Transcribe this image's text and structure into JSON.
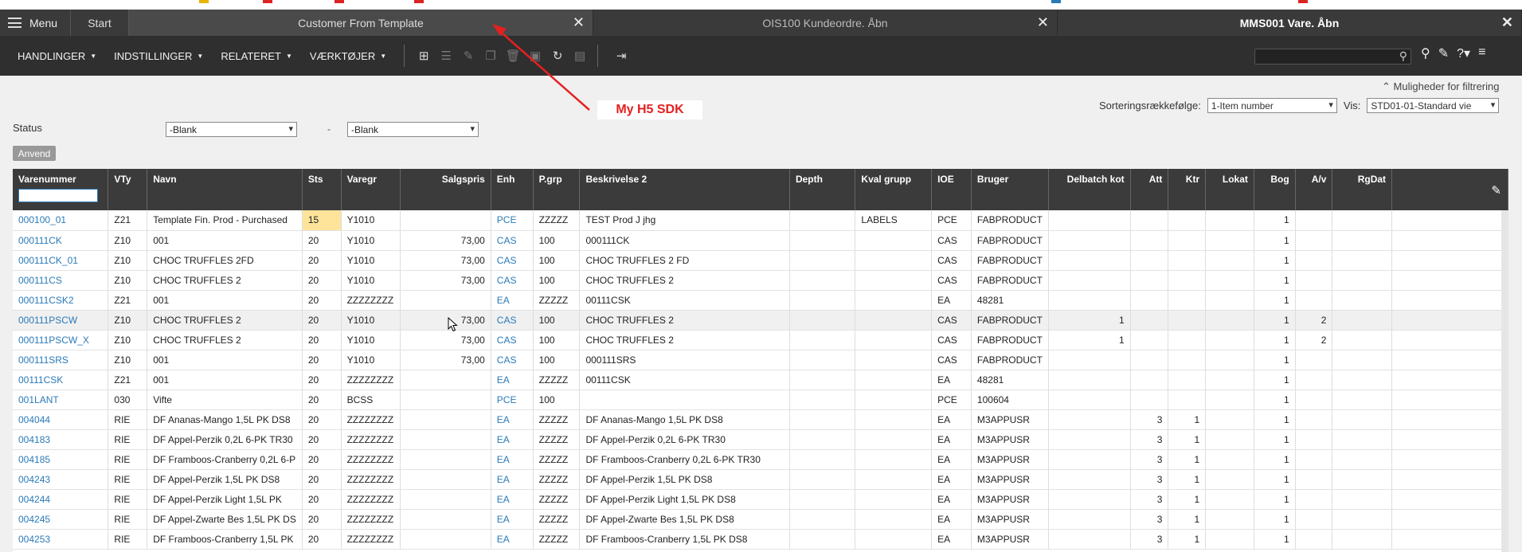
{
  "tabs": {
    "menu_label": "Menu",
    "start_label": "Start",
    "items": [
      {
        "title": "Customer From Template",
        "close": "✕"
      },
      {
        "title": "OIS100 Kundeordre. Åbn",
        "close": "✕"
      },
      {
        "title": "MMS001 Vare. Åbn",
        "close": "✕"
      }
    ]
  },
  "toolbar": {
    "menus": [
      "HANDLINGER",
      "INDSTILLINGER",
      "RELATERET",
      "VÆRKTØJER"
    ]
  },
  "filter": {
    "show_options": "Muligheder for filtrering",
    "sort_label": "Sorteringsrækkefølge:",
    "sort_value": "1-Item number",
    "view_label": "Vis:",
    "view_value": "STD01-01-Standard vie",
    "status_label": "Status",
    "status_from": "-Blank",
    "dash": "-",
    "status_to": "-Blank",
    "apply_label": "Anvend"
  },
  "annotation": "My H5 SDK",
  "grid": {
    "columns": [
      "Varenummer",
      "VTy",
      "Navn",
      "Sts",
      "Varegr",
      "Salgspris",
      "Enh",
      "P.grp",
      "Beskrivelse 2",
      "Depth",
      "Kval grupp",
      "IOE",
      "Bruger",
      "Delbatch kot",
      "Att",
      "Ktr",
      "Lokat",
      "Bog",
      "A/v",
      "RgDat"
    ],
    "rows": [
      [
        "000100_01",
        "Z21",
        "Template Fin. Prod - Purchased",
        "15",
        "Y1010",
        "",
        "PCE",
        "ZZZZZ",
        "TEST Prod J jhg",
        "",
        "LABELS",
        "PCE",
        "FABPRODUCT",
        "",
        "",
        "",
        "",
        "1",
        "",
        ""
      ],
      [
        "000111CK",
        "Z10",
        "001",
        "20",
        "Y1010",
        "73,00",
        "CAS",
        "100",
        "000111CK",
        "",
        "",
        "CAS",
        "FABPRODUCT",
        "",
        "",
        "",
        "",
        "1",
        "",
        ""
      ],
      [
        "000111CK_01",
        "Z10",
        "CHOC TRUFFLES 2FD",
        "20",
        "Y1010",
        "73,00",
        "CAS",
        "100",
        "CHOC TRUFFLES 2 FD",
        "",
        "",
        "CAS",
        "FABPRODUCT",
        "",
        "",
        "",
        "",
        "1",
        "",
        ""
      ],
      [
        "000111CS",
        "Z10",
        "CHOC TRUFFLES 2",
        "20",
        "Y1010",
        "73,00",
        "CAS",
        "100",
        "CHOC TRUFFLES 2",
        "",
        "",
        "CAS",
        "FABPRODUCT",
        "",
        "",
        "",
        "",
        "1",
        "",
        ""
      ],
      [
        "000111CSK2",
        "Z21",
        "001",
        "20",
        "ZZZZZZZZ",
        "",
        "EA",
        "ZZZZZ",
        "00111CSK",
        "",
        "",
        "EA",
        "48281",
        "",
        "",
        "",
        "",
        "1",
        "",
        ""
      ],
      [
        "000111PSCW",
        "Z10",
        "CHOC TRUFFLES 2",
        "20",
        "Y1010",
        "73,00",
        "CAS",
        "100",
        "CHOC TRUFFLES 2",
        "",
        "",
        "CAS",
        "FABPRODUCT",
        "1",
        "",
        "",
        "",
        "1",
        "2",
        ""
      ],
      [
        "000111PSCW_X",
        "Z10",
        "CHOC TRUFFLES 2",
        "20",
        "Y1010",
        "73,00",
        "CAS",
        "100",
        "CHOC TRUFFLES 2",
        "",
        "",
        "CAS",
        "FABPRODUCT",
        "1",
        "",
        "",
        "",
        "1",
        "2",
        ""
      ],
      [
        "000111SRS",
        "Z10",
        "001",
        "20",
        "Y1010",
        "73,00",
        "CAS",
        "100",
        "000111SRS",
        "",
        "",
        "CAS",
        "FABPRODUCT",
        "",
        "",
        "",
        "",
        "1",
        "",
        ""
      ],
      [
        "00111CSK",
        "Z21",
        "001",
        "20",
        "ZZZZZZZZ",
        "",
        "EA",
        "ZZZZZ",
        "00111CSK",
        "",
        "",
        "EA",
        "48281",
        "",
        "",
        "",
        "",
        "1",
        "",
        ""
      ],
      [
        "001LANT",
        "030",
        "Vifte",
        "20",
        "BCSS",
        "",
        "PCE",
        "100",
        "",
        "",
        "",
        "PCE",
        "100604",
        "",
        "",
        "",
        "",
        "1",
        "",
        ""
      ],
      [
        "004044",
        "RIE",
        "DF Ananas-Mango 1,5L PK DS8",
        "20",
        "ZZZZZZZZ",
        "",
        "EA",
        "ZZZZZ",
        "DF Ananas-Mango 1,5L PK DS8",
        "",
        "",
        "EA",
        "M3APPUSR",
        "",
        "3",
        "1",
        "",
        "1",
        "",
        ""
      ],
      [
        "004183",
        "RIE",
        "DF Appel-Perzik 0,2L 6-PK TR30",
        "20",
        "ZZZZZZZZ",
        "",
        "EA",
        "ZZZZZ",
        "DF Appel-Perzik 0,2L 6-PK TR30",
        "",
        "",
        "EA",
        "M3APPUSR",
        "",
        "3",
        "1",
        "",
        "1",
        "",
        ""
      ],
      [
        "004185",
        "RIE",
        "DF Framboos-Cranberry 0,2L 6-P",
        "20",
        "ZZZZZZZZ",
        "",
        "EA",
        "ZZZZZ",
        "DF Framboos-Cranberry 0,2L 6-PK TR30",
        "",
        "",
        "EA",
        "M3APPUSR",
        "",
        "3",
        "1",
        "",
        "1",
        "",
        ""
      ],
      [
        "004243",
        "RIE",
        "DF Appel-Perzik 1,5L PK DS8",
        "20",
        "ZZZZZZZZ",
        "",
        "EA",
        "ZZZZZ",
        "DF Appel-Perzik 1,5L PK DS8",
        "",
        "",
        "EA",
        "M3APPUSR",
        "",
        "3",
        "1",
        "",
        "1",
        "",
        ""
      ],
      [
        "004244",
        "RIE",
        "DF Appel-Perzik Light 1,5L PK",
        "20",
        "ZZZZZZZZ",
        "",
        "EA",
        "ZZZZZ",
        "DF Appel-Perzik Light 1,5L PK DS8",
        "",
        "",
        "EA",
        "M3APPUSR",
        "",
        "3",
        "1",
        "",
        "1",
        "",
        ""
      ],
      [
        "004245",
        "RIE",
        "DF Appel-Zwarte Bes 1,5L PK DS",
        "20",
        "ZZZZZZZZ",
        "",
        "EA",
        "ZZZZZ",
        "DF Appel-Zwarte Bes 1,5L PK DS8",
        "",
        "",
        "EA",
        "M3APPUSR",
        "",
        "3",
        "1",
        "",
        "1",
        "",
        ""
      ],
      [
        "004253",
        "RIE",
        "DF Framboos-Cranberry 1,5L PK",
        "20",
        "ZZZZZZZZ",
        "",
        "EA",
        "ZZZZZ",
        "DF Framboos-Cranberry 1,5L PK DS8",
        "",
        "",
        "EA",
        "M3APPUSR",
        "",
        "3",
        "1",
        "",
        "1",
        "",
        ""
      ]
    ]
  }
}
